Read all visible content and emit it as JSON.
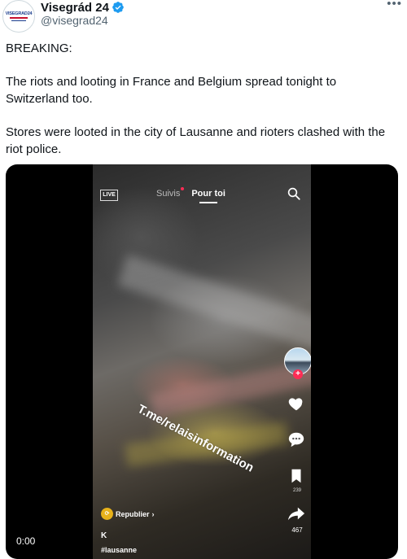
{
  "account": {
    "display_name": "Visegrád 24",
    "handle": "@visegrad24",
    "avatar_text": "VISEGRAD24",
    "verified": true,
    "more_label": "•••"
  },
  "tweet": {
    "lines": [
      "BREAKING:",
      "The riots and looting in France and Belgium spread tonight to Switzerland too.",
      "Stores were looted in the city of Lausanne and rioters clashed with the riot police."
    ]
  },
  "video": {
    "timestamp": "0:00",
    "tiktok": {
      "live_label": "LIVE",
      "tab_following": "Suivis",
      "tab_for_you": "Pour toi",
      "watermark": "T.me/relaisinformation",
      "like_count": "",
      "comment_count": "",
      "save_count": "239",
      "share_count": "467",
      "republish_label": "Republier",
      "republish_chevron": "›",
      "username": "K",
      "hashtag": "#lausanne"
    }
  },
  "colors": {
    "verified_blue": "#1d9bf0",
    "text_primary": "#0f1419",
    "text_secondary": "#536471",
    "tiktok_red": "#fe2c55",
    "republish_gold": "#e8b21a"
  }
}
